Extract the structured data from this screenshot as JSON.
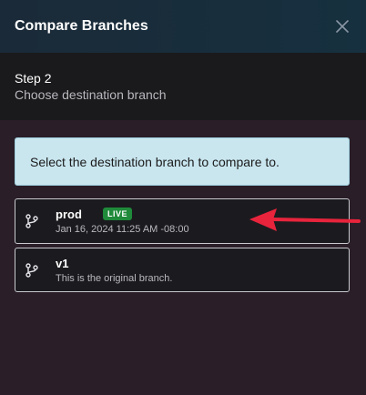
{
  "header": {
    "title": "Compare Branches",
    "close_icon": "close-icon"
  },
  "step": {
    "label": "Step 2",
    "subtitle": "Choose destination branch"
  },
  "info": {
    "text": "Select the destination branch to compare to."
  },
  "branches": [
    {
      "name": "prod",
      "badge": "LIVE",
      "meta": "Jan 16, 2024 11:25 AM -08:00",
      "icon": "branch-icon"
    },
    {
      "name": "v1",
      "meta": "This is the original branch.",
      "icon": "branch-icon"
    }
  ],
  "colors": {
    "header_bg": "#1b2a38",
    "step_bg": "#1a1a1c",
    "body_bg": "#2a1e28",
    "info_bg": "#c9e6ef",
    "live_badge": "#1f8a3a",
    "annotation_arrow": "#e8243c"
  }
}
